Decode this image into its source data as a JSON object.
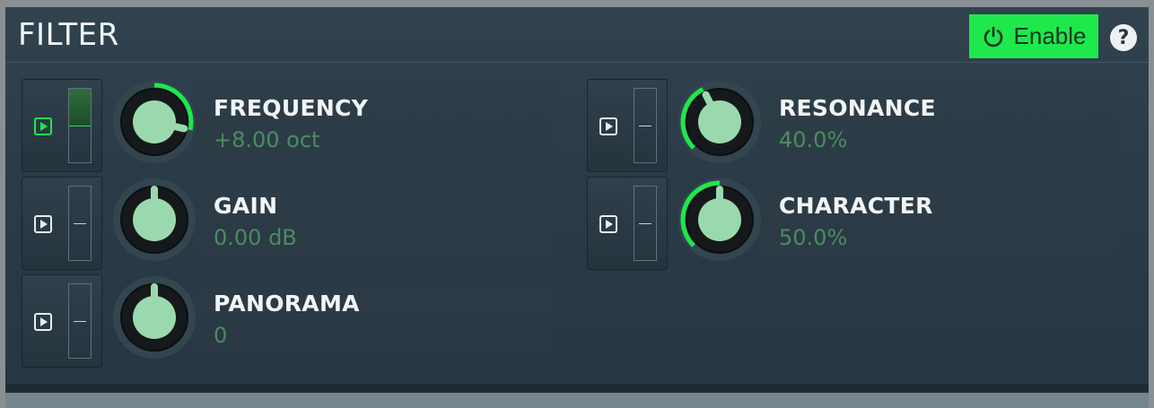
{
  "panel": {
    "title": "FILTER",
    "enable_label": "Enable",
    "help_label": "?"
  },
  "params": [
    {
      "name": "FREQUENCY",
      "value": "+8.00 oct",
      "knob_fraction": 0.88,
      "arc_from": 0.5,
      "modulation_active": true,
      "modulation_depth": 0.5
    },
    {
      "name": "RESONANCE",
      "value": "40.0%",
      "knob_fraction": 0.4,
      "arc_from": 0.0,
      "modulation_active": false,
      "modulation_depth": 0
    },
    {
      "name": "GAIN",
      "value": "0.00 dB",
      "knob_fraction": 0.5,
      "arc_from": 0.5,
      "modulation_active": false,
      "modulation_depth": 0
    },
    {
      "name": "CHARACTER",
      "value": "50.0%",
      "knob_fraction": 0.5,
      "arc_from": 0.0,
      "modulation_active": false,
      "modulation_depth": 0
    },
    {
      "name": "PANORAMA",
      "value": "0",
      "knob_fraction": 0.5,
      "arc_from": 0.5,
      "modulation_active": false,
      "modulation_depth": 0
    }
  ],
  "colors": {
    "accent": "#1ee84c",
    "knob_face": "#9ad9ae",
    "value_text": "#4c8b61"
  }
}
